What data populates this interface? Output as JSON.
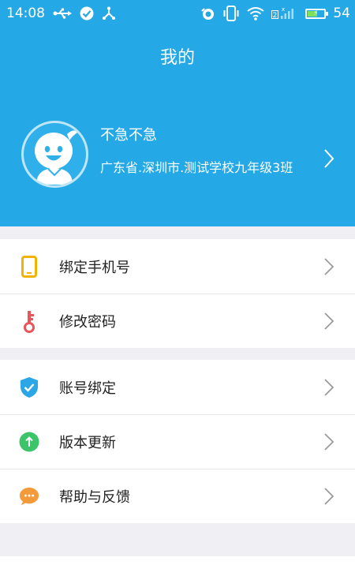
{
  "status_bar": {
    "time": "14:08",
    "battery_level": "54",
    "left_icons": [
      "usb-icon",
      "check-circle-icon",
      "share-network-icon"
    ],
    "right_icons": [
      "alarm-icon",
      "vibrate-icon",
      "wifi-icon",
      "signal-icon",
      "battery-icon"
    ],
    "sim_slot": "2"
  },
  "header": {
    "title": "我的",
    "background_color": "#25a8e6"
  },
  "profile": {
    "nickname": "不急不急",
    "location": "广东省.深圳市.测试学校九年级3班",
    "avatar_icon": "smiley-avatar-icon"
  },
  "menu_groups": [
    {
      "items": [
        {
          "label": "绑定手机号",
          "icon": "phone-icon",
          "color": "#f0b400"
        },
        {
          "label": "修改密码",
          "icon": "key-icon",
          "color": "#e8555a"
        }
      ]
    },
    {
      "items": [
        {
          "label": "账号绑定",
          "icon": "shield-check-icon",
          "color": "#2ba6e6"
        },
        {
          "label": "版本更新",
          "icon": "arrow-up-circle-icon",
          "color": "#3bc46a"
        },
        {
          "label": "帮助与反馈",
          "icon": "chat-bubble-icon",
          "color": "#f39a3b"
        }
      ]
    }
  ]
}
